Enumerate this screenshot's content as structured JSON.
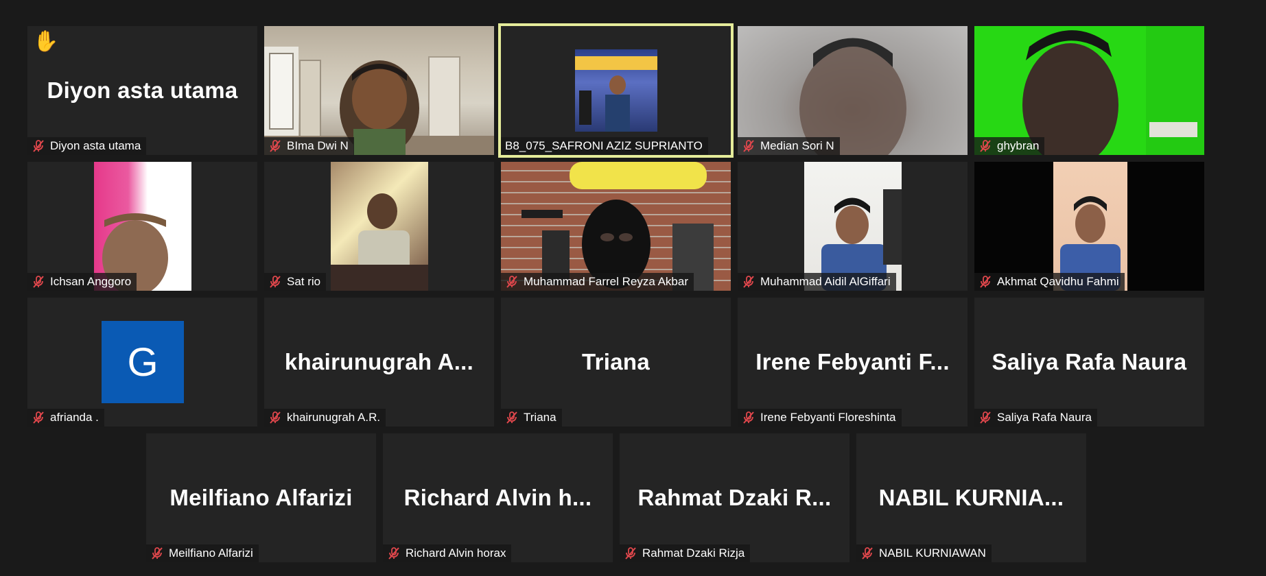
{
  "participants": [
    {
      "name": "Diyon asta utama",
      "display": "Diyon asta utama",
      "hand_raised": true,
      "hand_icon": "✋"
    },
    {
      "name": "BIma Dwi N"
    },
    {
      "name": "B8_075_SAFRONI AZIZ SUPRIANTO"
    },
    {
      "name": "Median Sori N"
    },
    {
      "name": "ghybran"
    },
    {
      "name": "Ichsan Anggoro"
    },
    {
      "name": "Sat rio"
    },
    {
      "name": "Muhammad Farrel Reyza Akbar"
    },
    {
      "name": "Muhammad Aidil AlGiffari"
    },
    {
      "name": "Akhmat Qavidhu Fahmi"
    },
    {
      "name": "afrianda .",
      "avatar_letter": "G"
    },
    {
      "name": "khairunugrah A.R.",
      "display": "khairunugrah  A..."
    },
    {
      "name": "Triana",
      "display": "Triana"
    },
    {
      "name": "Irene Febyanti Floreshinta",
      "display": "Irene  Febyanti  F..."
    },
    {
      "name": "Saliya Rafa Naura",
      "display": "Saliya Rafa Naura"
    },
    {
      "name": "Meilfiano Alfarizi",
      "display": "Meilfiano Alfarizi"
    },
    {
      "name": "Richard Alvin horax",
      "display": "Richard  Alvin  h..."
    },
    {
      "name": "Rahmat Dzaki Rizja",
      "display": "Rahmat  Dzaki  R..."
    },
    {
      "name": "NABIL KURNIAWAN",
      "display": "NABIL  KURNIA..."
    }
  ],
  "colors": {
    "background": "#1a1a1a",
    "tile": "#242424",
    "active_speaker_border": "#e5ec9a",
    "mute_icon": "#e0474c",
    "avatar": "#0a5ab4"
  },
  "icons": {
    "mute": "microphone-muted-icon",
    "hand": "raised-hand-icon"
  }
}
